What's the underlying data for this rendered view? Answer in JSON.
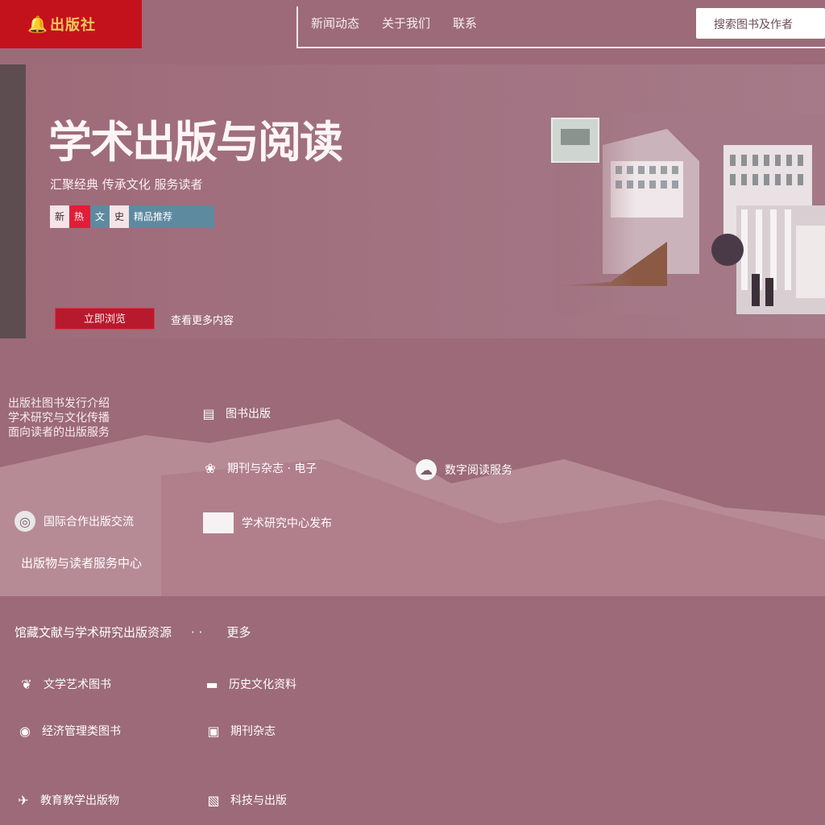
{
  "header": {
    "logo_text": "出版社",
    "nav": [
      "新闻动态",
      "关于我们",
      "联系"
    ],
    "search_placeholder": "搜索图书及作者"
  },
  "hero": {
    "title": "学术出版与阅读",
    "subtitle": "汇聚经典 传承文化 服务读者",
    "tags": [
      "新",
      "热",
      "文",
      "史",
      "精品推荐"
    ],
    "button_label": "立即浏览",
    "link_label": "查看更多内容"
  },
  "content": {
    "intro_lines": [
      "出版社图书发行介绍",
      "学术研究与文化传播",
      "面向读者的出版服务"
    ],
    "services": [
      {
        "icon": "book-icon",
        "label": "图书出版"
      },
      {
        "icon": "gift-icon",
        "label": "期刊与杂志 · 电子"
      },
      {
        "icon": "cloud-icon",
        "label": "数字阅读服务"
      },
      {
        "icon": "globe-icon",
        "label": "国际合作出版交流"
      },
      {
        "icon": "card-icon",
        "label": "学术研究中心发布"
      }
    ],
    "section_label": "出版物与读者服务中心",
    "list_heading": "馆藏文献与学术研究出版资源",
    "list_more": "更多",
    "links": [
      {
        "icon": "leaf-icon",
        "label": "文学艺术图书"
      },
      {
        "icon": "archive-icon",
        "label": "历史文化资料"
      },
      {
        "icon": "coin-icon",
        "label": "经济管理类图书"
      },
      {
        "icon": "frame-icon",
        "label": "期刊杂志"
      },
      {
        "icon": "bird-icon",
        "label": "教育教学出版物"
      },
      {
        "icon": "box-icon",
        "label": "科技与出版"
      }
    ]
  }
}
